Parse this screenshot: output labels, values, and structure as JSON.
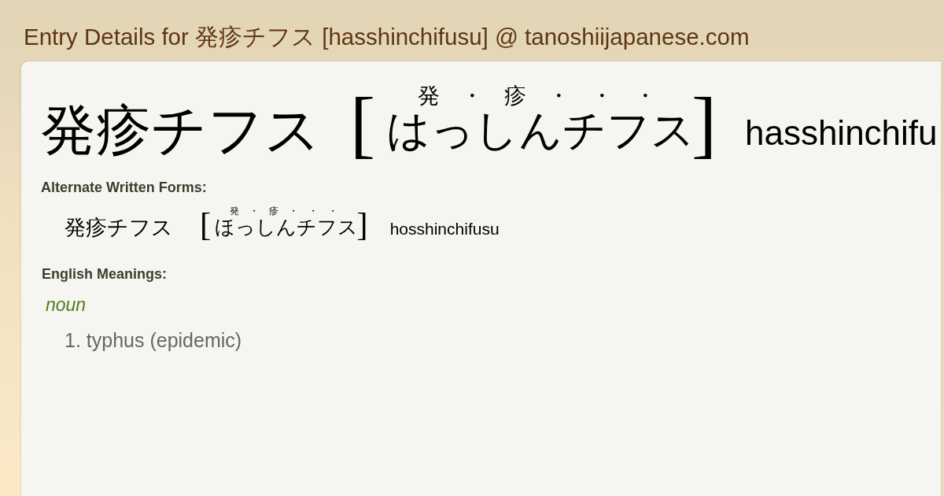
{
  "page_title": "Entry Details for 発疹チフス [hasshinchifusu] @ tanoshiijapanese.com",
  "entry": {
    "headword": "発疹チフス",
    "reading": {
      "open_bracket": "[",
      "marks": [
        "発",
        "・",
        "疹",
        "・",
        "・",
        "・"
      ],
      "kana": "はっしんチフス",
      "close_bracket": "]"
    },
    "romaji": "hasshinchifu"
  },
  "alternate_forms": {
    "heading": "Alternate Written Forms:",
    "forms": [
      {
        "written": "発疹チフス",
        "reading": {
          "open_bracket": "[",
          "marks": [
            "発",
            "・",
            "疹",
            "・",
            "・",
            "・"
          ],
          "kana": "ほっしんチフス",
          "close_bracket": "]"
        },
        "romaji": "hosshinchifusu"
      }
    ]
  },
  "meanings": {
    "heading": "English Meanings:",
    "groups": [
      {
        "part_of_speech": "noun",
        "items": [
          {
            "number": "1.",
            "text": "typhus (epidemic)"
          }
        ]
      }
    ]
  }
}
